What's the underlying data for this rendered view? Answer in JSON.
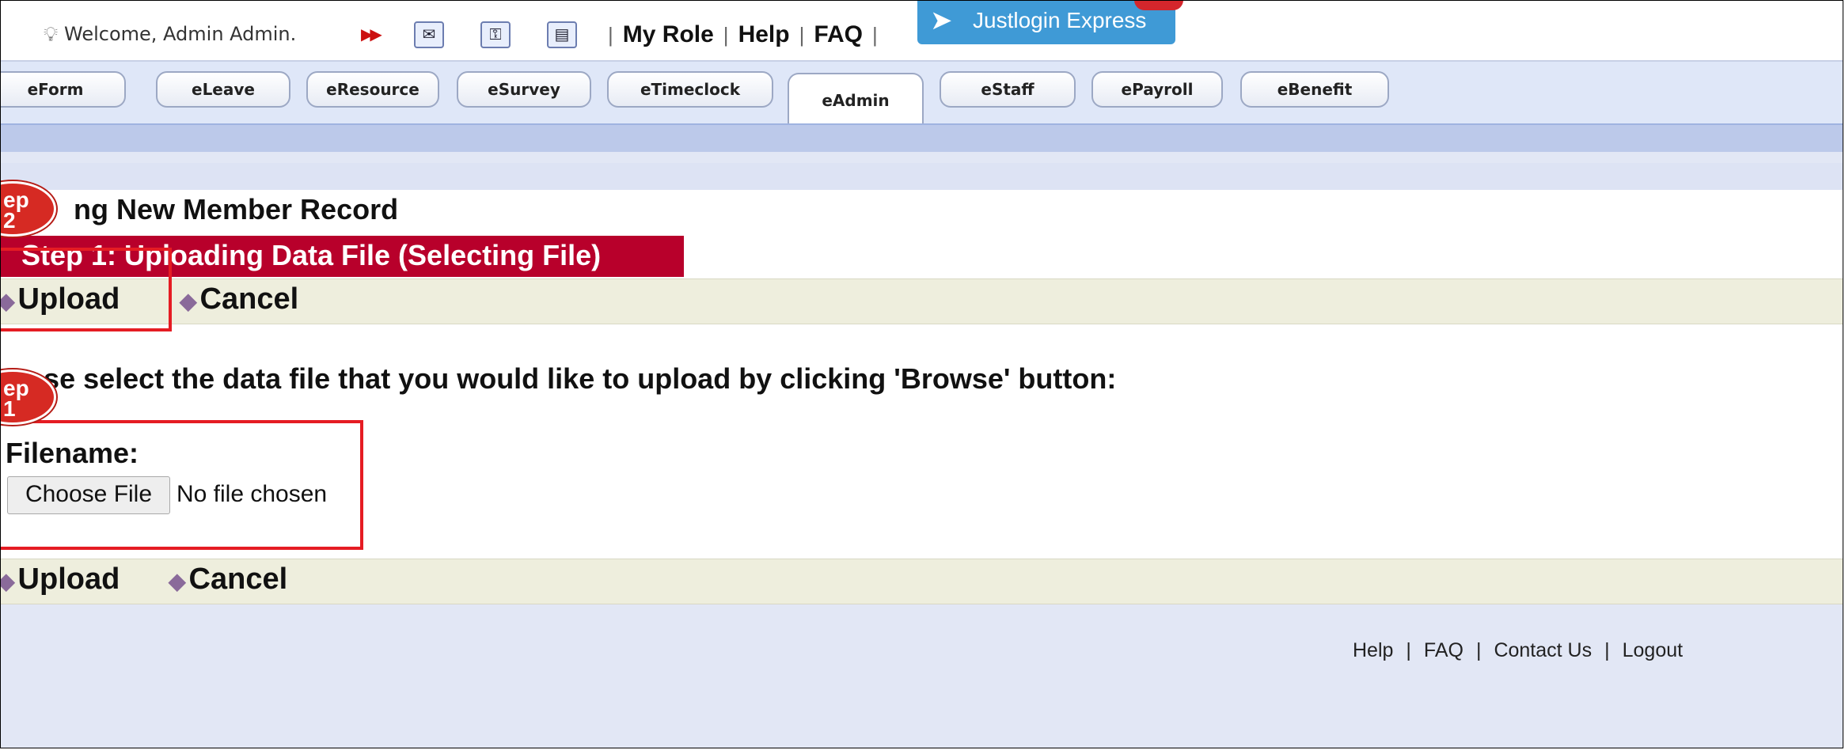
{
  "header": {
    "welcome": "Welcome, Admin Admin.",
    "links": [
      "My Role",
      "Help",
      "FAQ"
    ],
    "express_label": "Justlogin Express",
    "icons": [
      "lightbulb-icon",
      "double-arrow-icon",
      "mail-icon",
      "key-icon",
      "chat-icon",
      "paper-plane-icon"
    ]
  },
  "tabs": [
    "eForm",
    "eLeave",
    "eResource",
    "eSurvey",
    "eTimeclock",
    "eAdmin",
    "eStaff",
    "ePayroll",
    "eBenefit"
  ],
  "active_tab": "eAdmin",
  "page": {
    "title": "ng New Member Record",
    "step_banner": "Step 1: Uploading Data File (Selecting File)",
    "upload_label": "Upload",
    "cancel_label": "Cancel",
    "instruction": "ease select the data file that you would like to upload by clicking 'Browse' button:",
    "filename_label": "Filename:",
    "choose_file_label": "Choose File",
    "no_file_text": "No file chosen"
  },
  "annotations": {
    "step2_text": "ep\n2",
    "step1_text": "ep\n1"
  },
  "footer": {
    "links": [
      "Help",
      "FAQ",
      "Contact Us",
      "Logout"
    ]
  },
  "colors": {
    "step_banner": "#b8002b",
    "annotation_red": "#e51c23",
    "express_blue": "#3f9ad6"
  }
}
